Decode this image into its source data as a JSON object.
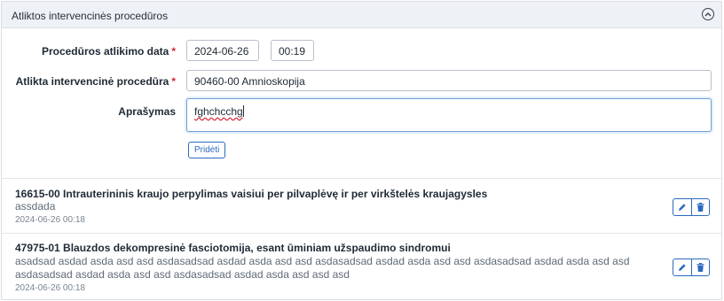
{
  "panel": {
    "title": "Atliktos intervencinės procedūros",
    "collapse_icon": "chevron-up-icon"
  },
  "form": {
    "date_label": "Procedūros atlikimo data",
    "date_value": "2024-06-26",
    "time_value": "00:19",
    "procedure_label": "Atlikta intervencinė procedūra",
    "procedure_value": "90460-00 Amnioskopija",
    "description_label": "Aprašymas",
    "description_value": "fghchcchg",
    "required_mark": "*",
    "add_button": "Pridėti"
  },
  "procedures": [
    {
      "title": "16615-00 Intrauterininis kraujo perpylimas vaisiui per pilvaplėvę ir per virkštelės kraujagysles",
      "description": "assdada",
      "date": "2024-06-26 00:18",
      "edit_icon": "pencil-icon",
      "delete_icon": "trash-icon"
    },
    {
      "title": "47975-01 Blauzdos dekompresinė fasciotomija, esant ūminiam užspaudimo sindromui",
      "description": "asadsad asdad asda asd asd asdasadsad asdad asda asd asd asdasadsad asdad asda asd asd asdasadsad asdad asda asd asd asdasadsad asdad asda asd asd asdasadsad asdad asda asd asd asd",
      "date": "2024-06-26 00:18",
      "edit_icon": "pencil-icon",
      "delete_icon": "trash-icon"
    }
  ],
  "colors": {
    "accent": "#2b6bbf",
    "required": "#d6283b",
    "header_bg": "#eef1f5"
  }
}
